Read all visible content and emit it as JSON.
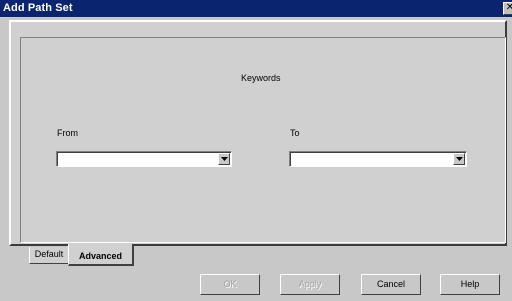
{
  "window": {
    "title": "Add Path Set",
    "close_glyph": "✕"
  },
  "panel": {
    "keywords_label": "Keywords",
    "from_label": "From",
    "to_label": "To",
    "from_value": "",
    "to_value": ""
  },
  "tabs": [
    {
      "label": "Default",
      "active": false
    },
    {
      "label": "Advanced",
      "active": true
    }
  ],
  "buttons": {
    "ok": {
      "label": "OK",
      "enabled": false
    },
    "apply": {
      "label": "Apply",
      "enabled": false
    },
    "cancel": {
      "label": "Cancel",
      "enabled": true
    },
    "help": {
      "label": "Help",
      "enabled": true
    }
  },
  "colors": {
    "titlebar": "#0a2470",
    "dialog_bg": "#c8c8c8",
    "panel_bg": "#d0d0d0"
  },
  "icons": {
    "close": "close-icon",
    "dropdown": "chevron-down-icon"
  }
}
